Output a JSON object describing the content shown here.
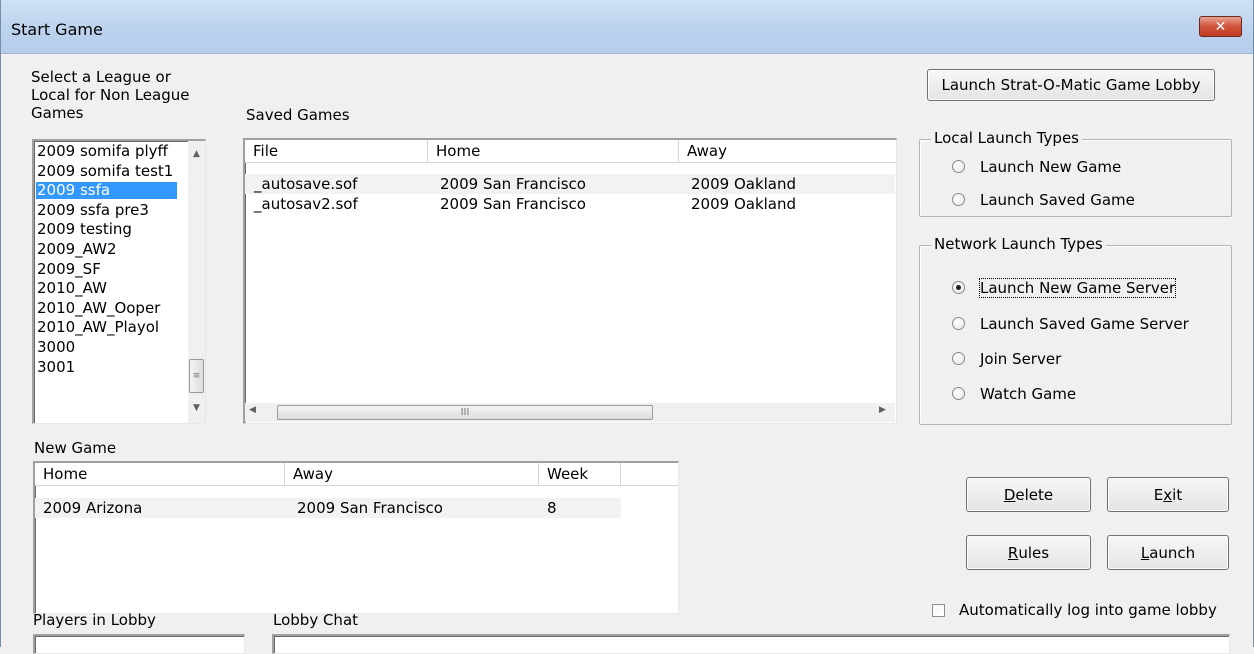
{
  "window": {
    "title": "Start Game",
    "close_symbol": "✕"
  },
  "league_list": {
    "label_line1": "Select a League or",
    "label_line2": "Local for Non League",
    "label_line3": "Games",
    "items": [
      "2009 somifa plyff",
      "2009 somifa test1",
      "2009 ssfa",
      "2009 ssfa pre3",
      "2009 testing",
      "2009_AW2",
      "2009_SF",
      "2010_AW",
      "2010_AW_Ooper",
      "2010_AW_Playol",
      "3000",
      "3001"
    ],
    "selected": "2009 ssfa"
  },
  "saved_games": {
    "label": "Saved Games",
    "columns": [
      "File",
      "Home",
      "Away"
    ],
    "rows": [
      {
        "file": "_autosave.sof",
        "home": "2009 San Francisco",
        "away": "2009 Oakland"
      },
      {
        "file": "_autosav2.sof",
        "home": "2009 San Francisco",
        "away": "2009 Oakland"
      }
    ],
    "hscroll_grip": "III"
  },
  "new_game": {
    "label": "New Game",
    "columns": [
      "Home",
      "Away",
      "Week"
    ],
    "rows": [
      {
        "home": "2009 Arizona",
        "away": "2009 San Francisco",
        "week": "8"
      }
    ]
  },
  "launch_lobby_button": "Launch Strat-O-Matic Game Lobby",
  "local_launch": {
    "title": "Local Launch Types",
    "options": [
      "Launch New Game",
      "Launch Saved Game"
    ]
  },
  "network_launch": {
    "title": "Network Launch Types",
    "options": [
      "Launch New Game Server",
      "Launch Saved Game Server",
      "Join Server",
      "Watch Game"
    ],
    "selected": "Launch New Game Server"
  },
  "buttons": {
    "delete_u": "D",
    "delete_rest": "elete",
    "exit_pre": "E",
    "exit_u": "x",
    "exit_rest": "it",
    "rules_u": "R",
    "rules_rest": "ules",
    "launch_u": "L",
    "launch_rest": "aunch"
  },
  "auto_login": {
    "label": "Automatically log into game lobby",
    "checked": false
  },
  "players_in_lobby": {
    "label": "Players in Lobby"
  },
  "lobby_chat": {
    "label": "Lobby Chat"
  }
}
